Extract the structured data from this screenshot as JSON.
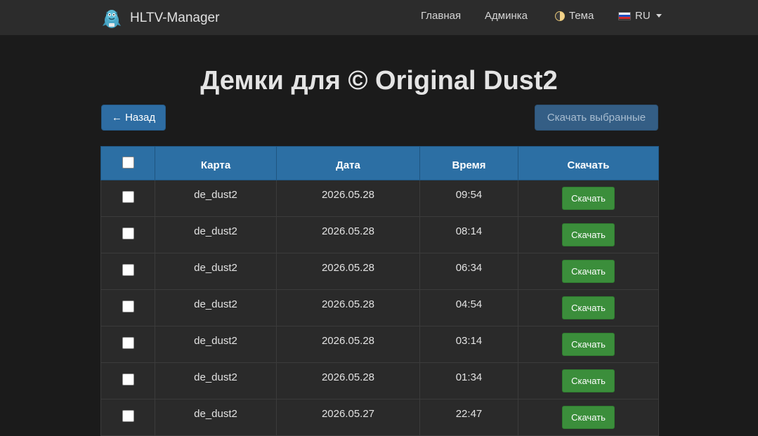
{
  "navbar": {
    "brand": "HLTV-Manager",
    "home": "Главная",
    "admin": "Админка",
    "theme": "Тема",
    "lang": "RU"
  },
  "page": {
    "title": "Демки для © Original Dust2",
    "back_label": "← Назад",
    "download_selected_label": "Скачать выбранные"
  },
  "table": {
    "headers": {
      "map": "Карта",
      "date": "Дата",
      "time": "Время",
      "download": "Скачать"
    },
    "rows": [
      {
        "map": "de_dust2",
        "date": "2026.05.28",
        "time": "09:54",
        "download": "Скачать"
      },
      {
        "map": "de_dust2",
        "date": "2026.05.28",
        "time": "08:14",
        "download": "Скачать"
      },
      {
        "map": "de_dust2",
        "date": "2026.05.28",
        "time": "06:34",
        "download": "Скачать"
      },
      {
        "map": "de_dust2",
        "date": "2026.05.28",
        "time": "04:54",
        "download": "Скачать"
      },
      {
        "map": "de_dust2",
        "date": "2026.05.28",
        "time": "03:14",
        "download": "Скачать"
      },
      {
        "map": "de_dust2",
        "date": "2026.05.28",
        "time": "01:34",
        "download": "Скачать"
      },
      {
        "map": "de_dust2",
        "date": "2026.05.27",
        "time": "22:47",
        "download": "Скачать"
      }
    ]
  },
  "colors": {
    "navbar_bg": "#2c2c2c",
    "page_bg": "#1b1b1b",
    "primary": "#2e6da3",
    "table_header": "#2c6fa4",
    "success": "#3b8e3b"
  },
  "icons": [
    "hltv-logo-icon",
    "theme-toggle-icon",
    "russia-flag-icon",
    "caret-down-icon"
  ]
}
